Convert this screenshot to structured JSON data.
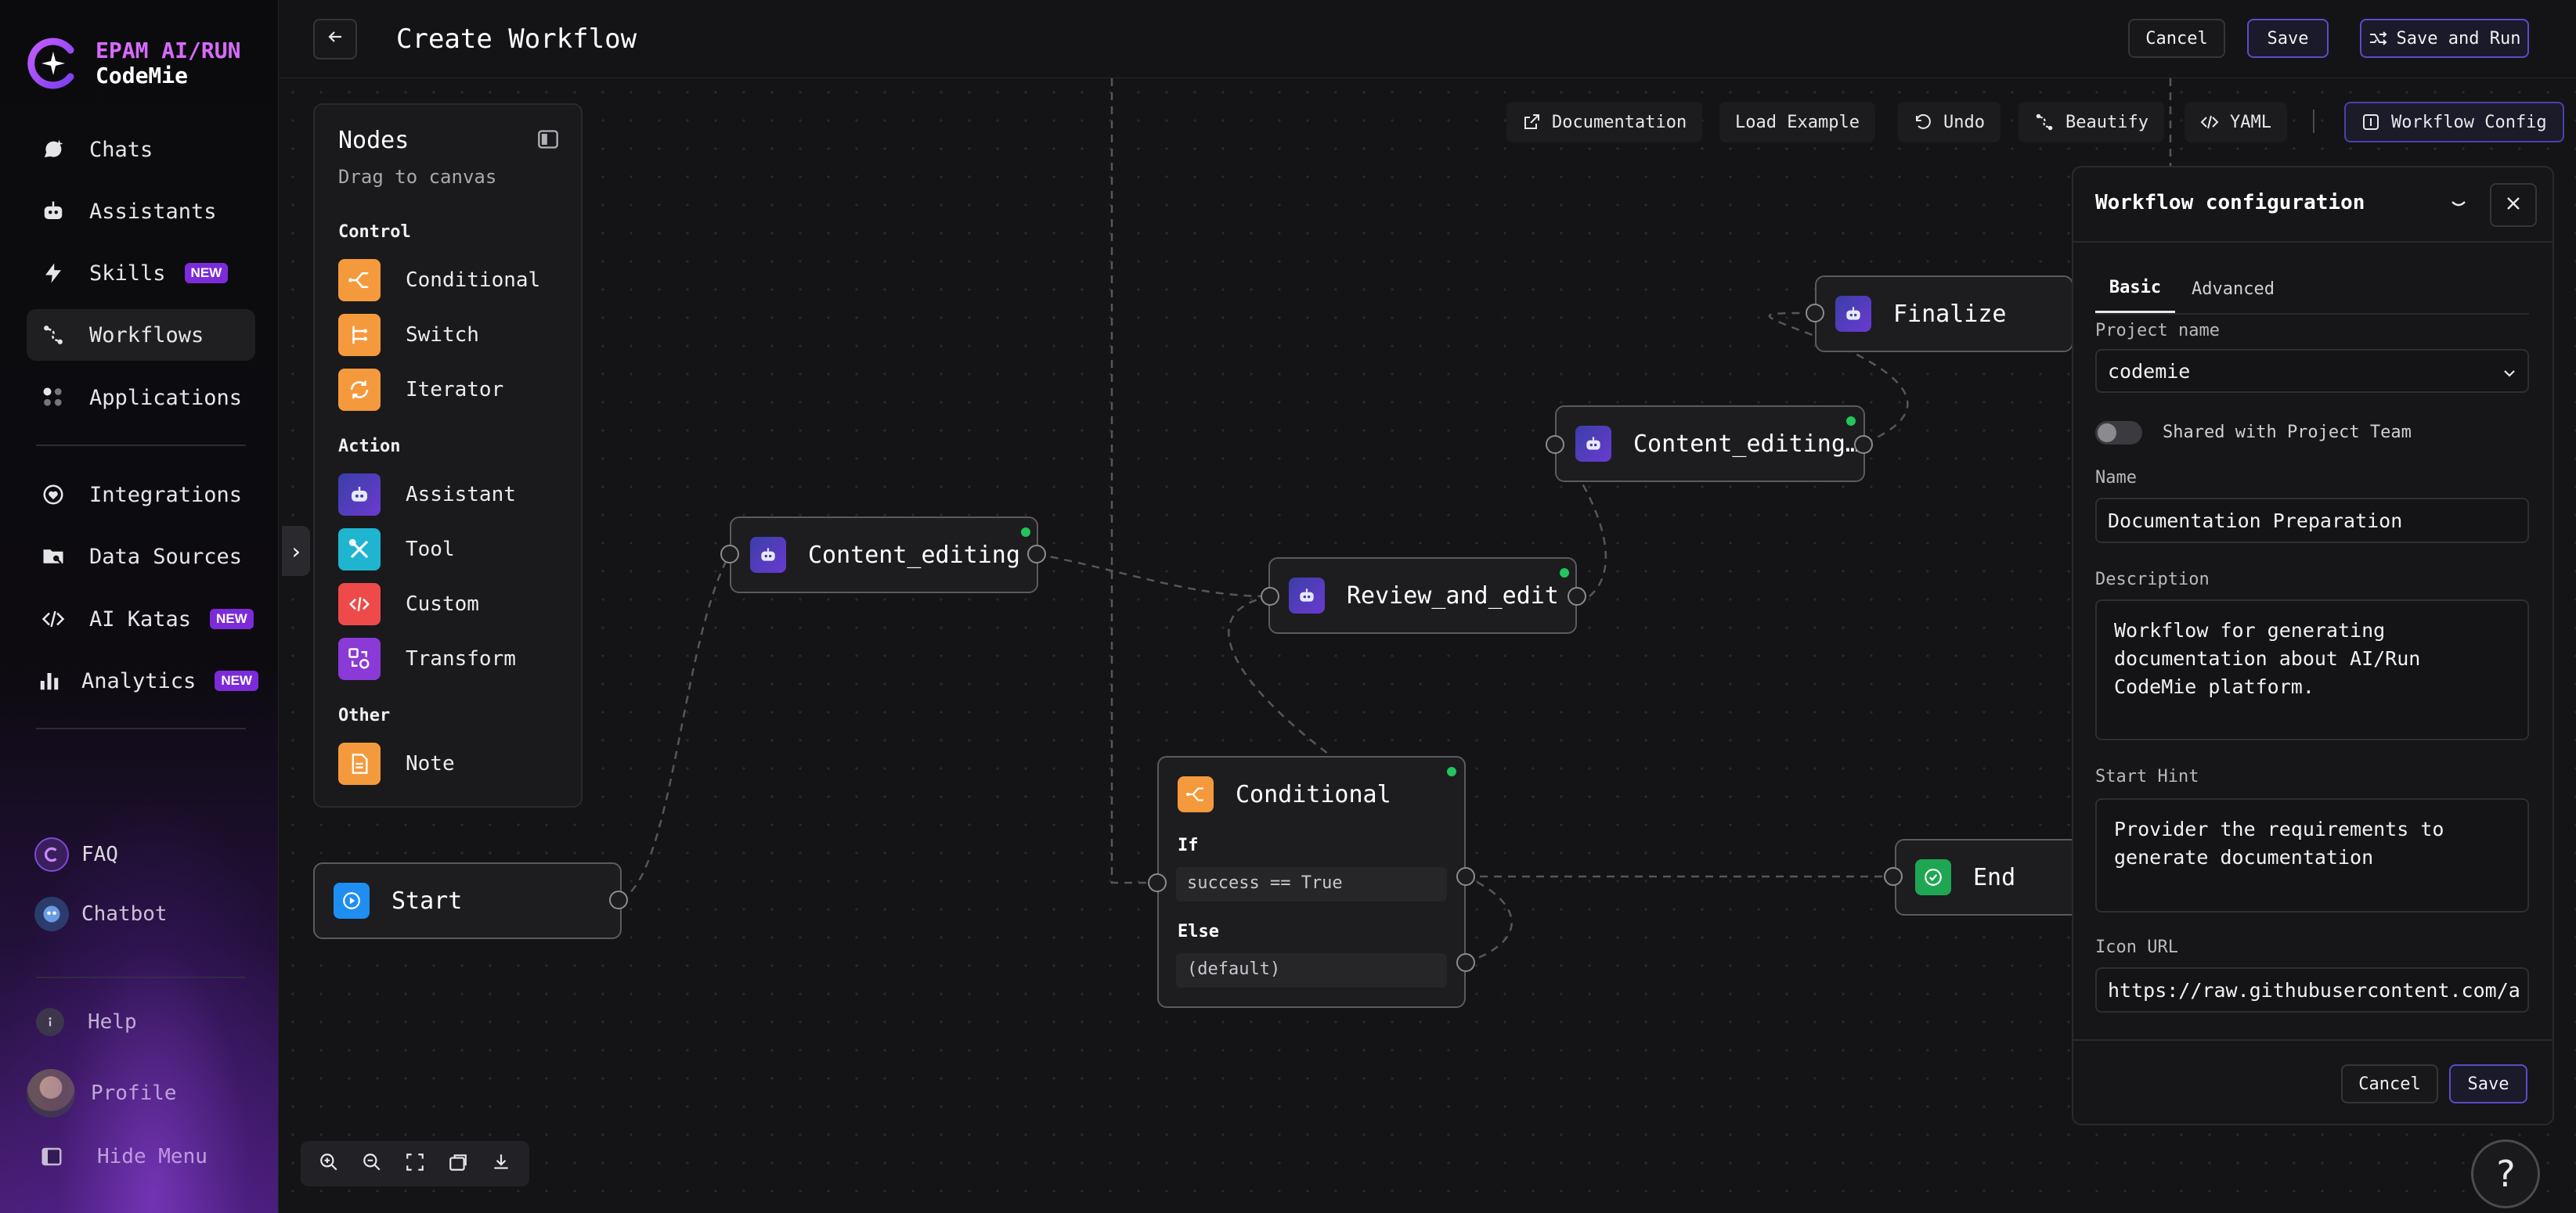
{
  "brand": {
    "line1": "EPAM AI/RUN",
    "line2": "CodeMie"
  },
  "sidebar": {
    "items": [
      {
        "label": "Chats"
      },
      {
        "label": "Assistants"
      },
      {
        "label": "Skills",
        "badge": "NEW"
      },
      {
        "label": "Workflows",
        "active": true
      },
      {
        "label": "Applications"
      },
      {
        "label": "Integrations"
      },
      {
        "label": "Data Sources"
      },
      {
        "label": "AI Katas",
        "badge": "NEW"
      },
      {
        "label": "Analytics",
        "badge": "NEW"
      }
    ],
    "faq": "FAQ",
    "chatbot": "Chatbot",
    "help": "Help",
    "profile": "Profile",
    "hide_menu": "Hide Menu"
  },
  "header": {
    "title": "Create Workflow",
    "cancel": "Cancel",
    "save": "Save",
    "save_and_run": "Save and Run"
  },
  "toolbar": {
    "documentation": "Documentation",
    "load_example": "Load Example",
    "undo": "Undo",
    "beautify": "Beautify",
    "yaml": "YAML",
    "workflow_config": "Workflow Config"
  },
  "nodes_panel": {
    "title": "Nodes",
    "subtitle": "Drag to canvas",
    "control_label": "Control",
    "control": [
      "Conditional",
      "Switch",
      "Iterator"
    ],
    "action_label": "Action",
    "action": [
      "Assistant",
      "Tool",
      "Custom",
      "Transform"
    ],
    "other_label": "Other",
    "other": [
      "Note"
    ]
  },
  "flow": {
    "start": "Start",
    "content_editing": "Content_editing",
    "review_and_edit": "Review_and_edit",
    "content_editing_2": "Content_editing…",
    "finalize": "Finalize",
    "conditional": "Conditional",
    "if_label": "If",
    "if_expr": "success == True",
    "else_label": "Else",
    "else_expr": "(default)",
    "end": "End"
  },
  "config": {
    "title": "Workflow configuration",
    "tabs": [
      "Basic",
      "Advanced"
    ],
    "project_name_label": "Project name",
    "project_name": "codemie",
    "shared_label": "Shared with Project Team",
    "name_label": "Name",
    "name": "Documentation Preparation",
    "description_label": "Description",
    "description": "Workflow for generating documentation about AI/Run CodeMie platform.",
    "start_hint_label": "Start Hint",
    "start_hint": "Provider the requirements to generate documentation",
    "icon_url_label": "Icon URL",
    "icon_url": "https://raw.githubusercontent.com/a",
    "cancel": "Cancel",
    "save": "Save"
  },
  "colors": {
    "accent_purple": "#7c2bd9",
    "orange": "#f59a3c",
    "teal": "#1fb5d0",
    "red": "#ef4a4a",
    "violet": "#8a3ad6",
    "assistant": "#4b3aa6",
    "start_blue": "#1f8ef1",
    "end_green": "#1fa653"
  }
}
